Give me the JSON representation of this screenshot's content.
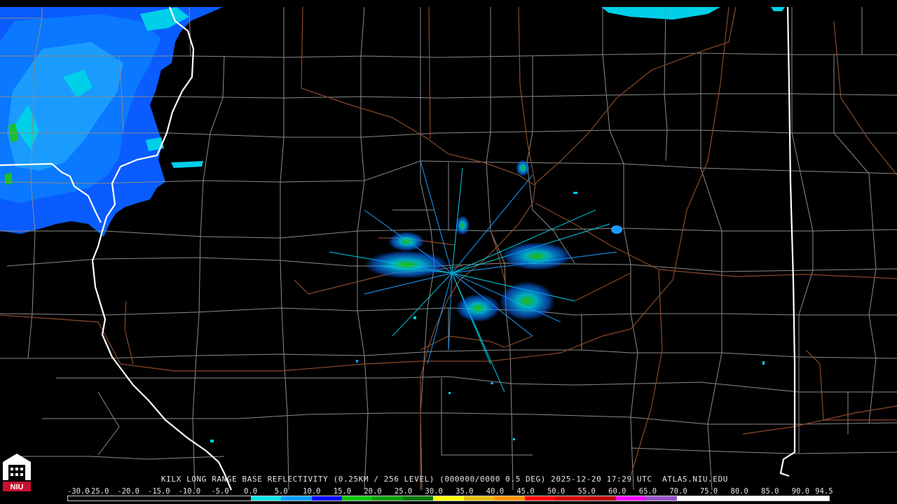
{
  "product": {
    "caption": "KILX LONG RANGE BASE REFLECTIVITY (0.25KM / 256 LEVEL) (000000/0000 0.5 DEG) 2025-12-20 17:29 UTC  ATLAS.NIU.EDU"
  },
  "logo": {
    "text": "NIU",
    "icon": "niu-tower-logo-icon",
    "color": "#c8102e"
  },
  "colors": {
    "background": "#000000",
    "county_lines": "#8a8a8a",
    "state_lines": "#ffffff",
    "highways": "#8b4a2b"
  },
  "legend": {
    "labels": [
      "-30.0",
      "-25.0",
      "-20.0",
      "-15.0",
      "-10.0",
      "-5.0",
      "0.0",
      "5.0",
      "10.0",
      "15.0",
      "20.0",
      "25.0",
      "30.0",
      "35.0",
      "40.0",
      "45.0",
      "50.0",
      "55.0",
      "60.0",
      "65.0",
      "70.0",
      "75.0",
      "80.0",
      "85.0",
      "90.0",
      "94.5"
    ],
    "colors": [
      "#000000",
      "#000000",
      "#000000",
      "#000000",
      "#000000",
      "#000000",
      "#00e5e5",
      "#009ffe",
      "#0000fe",
      "#00c800",
      "#00a000",
      "#007800",
      "#fcfc00",
      "#e5c000",
      "#fd9500",
      "#fd0000",
      "#d40000",
      "#bc0000",
      "#f800fd",
      "#9854c6",
      "#fdfdfd",
      "#fdfdfd",
      "#fdfdfd",
      "#fdfdfd",
      "#fdfdfd"
    ]
  }
}
